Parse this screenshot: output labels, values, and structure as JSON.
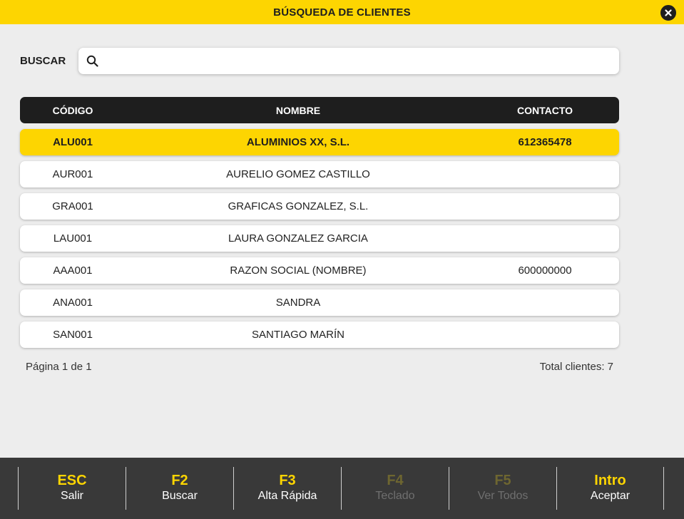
{
  "window": {
    "title": "BÚSQUEDA DE CLIENTES"
  },
  "search": {
    "label": "BUSCAR",
    "value": "",
    "placeholder": ""
  },
  "table": {
    "headers": [
      "CÓDIGO",
      "NOMBRE",
      "CONTACTO"
    ],
    "rows": [
      {
        "code": "ALU001",
        "name": "ALUMINIOS XX, S.L.",
        "contact": "612365478",
        "selected": true
      },
      {
        "code": "AUR001",
        "name": "AURELIO GOMEZ CASTILLO",
        "contact": ""
      },
      {
        "code": "GRA001",
        "name": "GRAFICAS GONZALEZ, S.L.",
        "contact": ""
      },
      {
        "code": "LAU001",
        "name": "LAURA GONZALEZ GARCIA",
        "contact": ""
      },
      {
        "code": "AAA001",
        "name": "RAZON SOCIAL (NOMBRE)",
        "contact": "600000000"
      },
      {
        "code": "ANA001",
        "name": "SANDRA",
        "contact": ""
      },
      {
        "code": "SAN001",
        "name": "SANTIAGO MARÍN",
        "contact": ""
      }
    ]
  },
  "pagination": {
    "page_text": "Página 1 de 1",
    "total_text": "Total clientes: 7"
  },
  "footer": {
    "keys": [
      {
        "key": "ESC",
        "label": "Salir",
        "enabled": true
      },
      {
        "key": "F2",
        "label": "Buscar",
        "enabled": true
      },
      {
        "key": "F3",
        "label": "Alta Rápida",
        "enabled": true
      },
      {
        "key": "F4",
        "label": "Teclado",
        "enabled": false
      },
      {
        "key": "F5",
        "label": "Ver Todos",
        "enabled": false
      },
      {
        "key": "Intro",
        "label": "Aceptar",
        "enabled": true
      }
    ]
  },
  "colors": {
    "accent": "#fdd501",
    "dark": "#1e1e1e",
    "footer_bg": "#393939",
    "page_bg": "#ededed"
  },
  "icons": {
    "close": "close-icon",
    "search": "search-icon"
  }
}
